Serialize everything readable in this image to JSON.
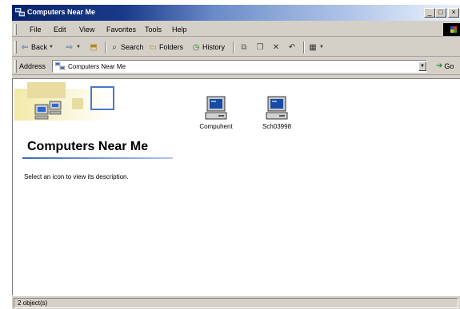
{
  "window": {
    "title": "Computers Near Me",
    "buttons": {
      "minimize": "_",
      "maximize": "□",
      "close": "×"
    }
  },
  "menubar": {
    "items": [
      {
        "label": "File"
      },
      {
        "label": "Edit"
      },
      {
        "label": "View"
      },
      {
        "label": "Favorites"
      },
      {
        "label": "Tools"
      },
      {
        "label": "Help"
      }
    ]
  },
  "toolbar": {
    "back": {
      "label": "Back",
      "icon": "back-arrow-icon"
    },
    "forward": {
      "icon": "forward-arrow-icon"
    },
    "up": {
      "icon": "up-folder-icon"
    },
    "search": {
      "label": "Search",
      "icon": "search-icon"
    },
    "folders": {
      "label": "Folders",
      "icon": "folders-icon"
    },
    "history": {
      "label": "History",
      "icon": "history-icon"
    },
    "move_to": {
      "icon": "move-to-icon"
    },
    "copy_to": {
      "icon": "copy-to-icon"
    },
    "delete": {
      "icon": "delete-icon"
    },
    "undo": {
      "icon": "undo-icon"
    },
    "views": {
      "icon": "views-icon"
    }
  },
  "addressbar": {
    "label": "Address",
    "value": "Computers Near Me",
    "go_label": "Go"
  },
  "webview": {
    "title": "Computers Near Me",
    "description": "Select an icon to view its description."
  },
  "items": [
    {
      "label": "Compuhent"
    },
    {
      "label": "Sch03998"
    }
  ],
  "statusbar": {
    "text": "2 object(s)"
  },
  "colors": {
    "title_active": "#0a246a",
    "face": "#d4d0c8",
    "accent_rule": "#3a6ab8"
  }
}
